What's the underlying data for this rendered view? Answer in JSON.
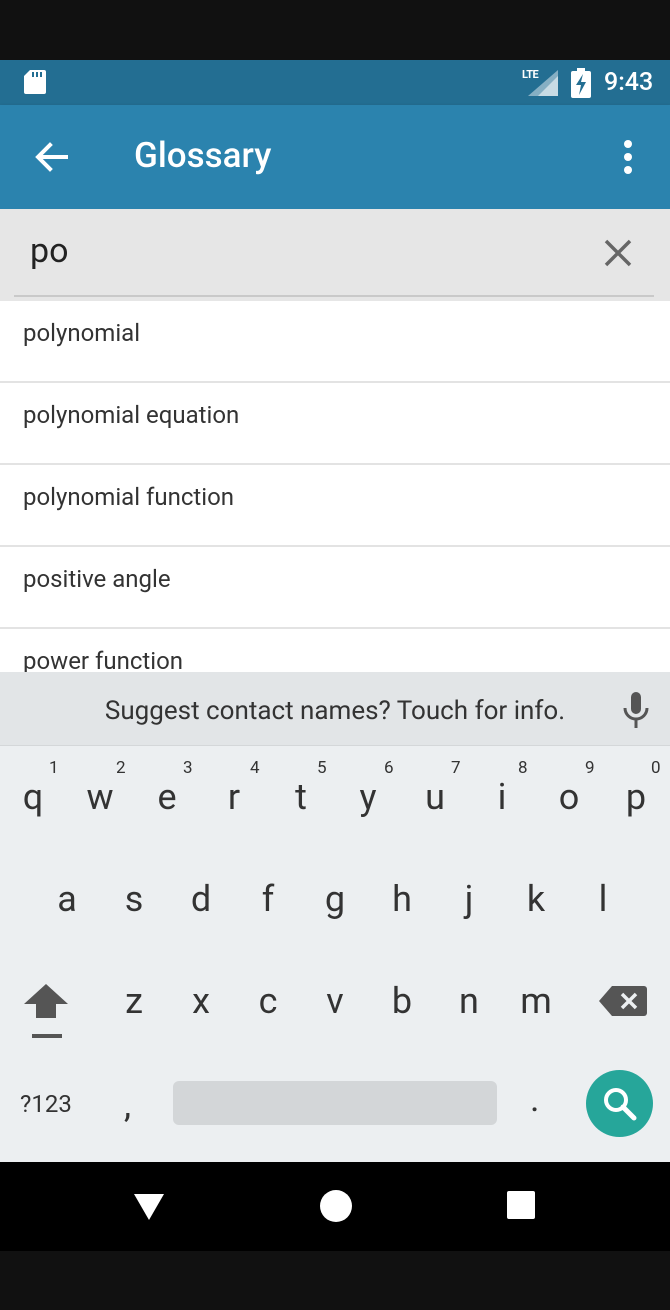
{
  "status_bar": {
    "network": "LTE",
    "time": "9:43"
  },
  "app_bar": {
    "title": "Glossary"
  },
  "search": {
    "query": "po"
  },
  "results": [
    {
      "label": "polynomial"
    },
    {
      "label": "polynomial equation"
    },
    {
      "label": "polynomial function"
    },
    {
      "label": "positive angle"
    },
    {
      "label": "power function"
    }
  ],
  "keyboard": {
    "suggestion": "Suggest contact names? Touch for info.",
    "row1": [
      {
        "key": "q",
        "hint": "1"
      },
      {
        "key": "w",
        "hint": "2"
      },
      {
        "key": "e",
        "hint": "3"
      },
      {
        "key": "r",
        "hint": "4"
      },
      {
        "key": "t",
        "hint": "5"
      },
      {
        "key": "y",
        "hint": "6"
      },
      {
        "key": "u",
        "hint": "7"
      },
      {
        "key": "i",
        "hint": "8"
      },
      {
        "key": "o",
        "hint": "9"
      },
      {
        "key": "p",
        "hint": "0"
      }
    ],
    "row2": [
      "a",
      "s",
      "d",
      "f",
      "g",
      "h",
      "j",
      "k",
      "l"
    ],
    "row3": [
      "z",
      "x",
      "c",
      "v",
      "b",
      "n",
      "m"
    ],
    "symbols_label": "?123",
    "comma": ",",
    "period": "."
  },
  "colors": {
    "status_bar": "#236e92",
    "app_bar": "#2b83ae",
    "search_key": "#26a69a"
  },
  "icons": {
    "back": "arrow-left-icon",
    "menu": "more-vert-icon",
    "clear": "close-icon",
    "mic": "microphone-icon",
    "shift": "shift-arrow-icon",
    "backspace": "backspace-icon",
    "search": "search-icon"
  }
}
